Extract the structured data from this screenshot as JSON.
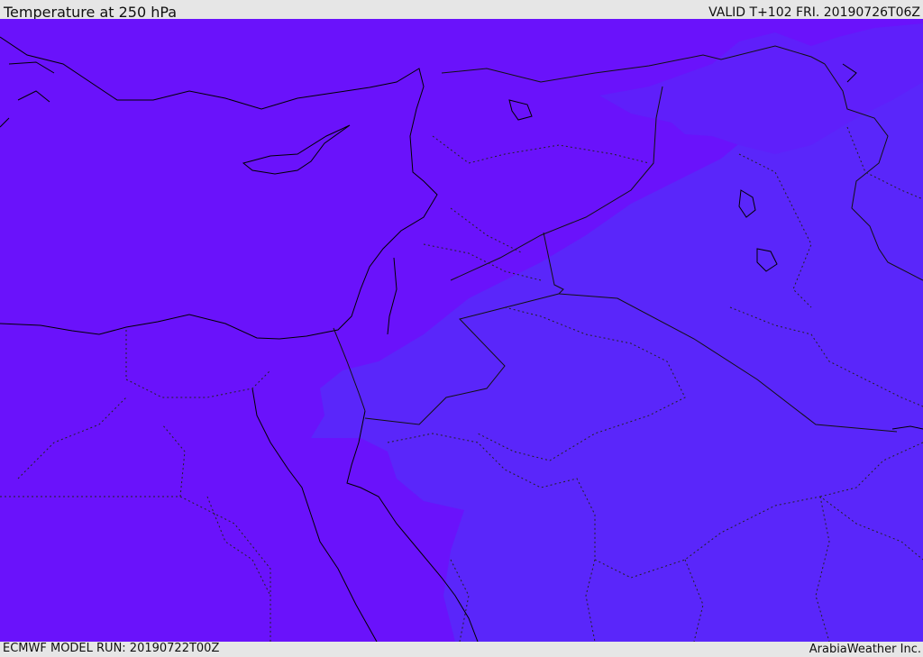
{
  "header": {
    "title": "Temperature at 250 hPa",
    "valid": "VALID T+102 FRI. 20190726T06Z"
  },
  "footer": {
    "model_run": "ECMWF MODEL RUN: 20190722T00Z",
    "credit": "ArabiaWeather Inc."
  },
  "map": {
    "colors": {
      "warm_fill": "#6a12fb",
      "cool_fill": "#5a26fa",
      "coastline": "#000000",
      "border": "#1a1a1a"
    }
  }
}
